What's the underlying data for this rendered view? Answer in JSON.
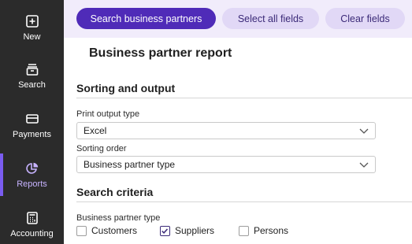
{
  "sidebar": {
    "items": [
      {
        "label": "New",
        "icon": "plus-square-icon"
      },
      {
        "label": "Search",
        "icon": "archive-icon"
      },
      {
        "label": "Payments",
        "icon": "card-icon"
      },
      {
        "label": "Reports",
        "icon": "pie-chart-icon",
        "active": true
      },
      {
        "label": "Accounting",
        "icon": "calculator-icon"
      }
    ]
  },
  "toolbar": {
    "search_label": "Search business partners",
    "select_all_label": "Select all fields",
    "clear_label": "Clear fields"
  },
  "page": {
    "title": "Business partner report"
  },
  "sorting": {
    "section_title": "Sorting and output",
    "print_output_label": "Print output type",
    "print_output_value": "Excel",
    "sorting_order_label": "Sorting order",
    "sorting_order_value": "Business partner type"
  },
  "criteria": {
    "section_title": "Search criteria",
    "bp_type_label": "Business partner type",
    "options": [
      {
        "label": "Customers",
        "checked": false
      },
      {
        "label": "Suppliers",
        "checked": true
      },
      {
        "label": "Persons",
        "checked": false
      }
    ]
  },
  "colors": {
    "primary": "#4f2bb8",
    "secondary": "#e1d8f6",
    "sidebar": "#2b2b2b",
    "active_nav": "#c7b3ff"
  }
}
